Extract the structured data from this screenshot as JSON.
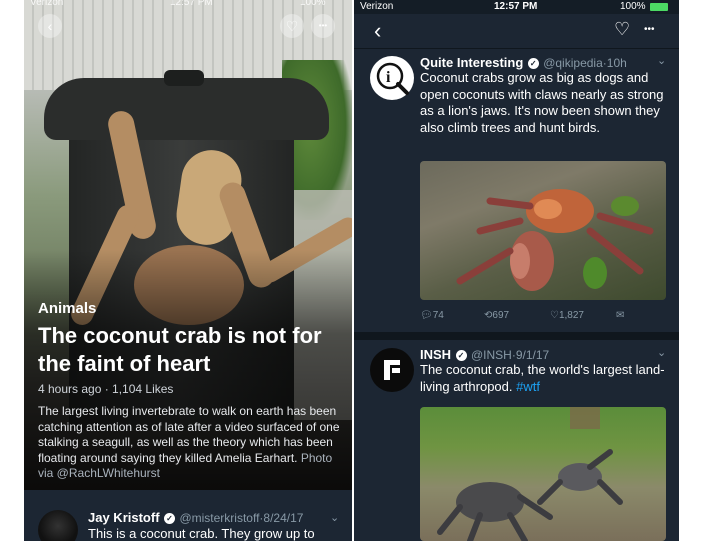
{
  "left_screen": {
    "status": {
      "carrier": "Verizon",
      "time": "12:57 PM",
      "battery": "100%"
    },
    "controls": {
      "back_icon": "‹",
      "like_icon": "♡",
      "more_icon": "•••"
    },
    "category": "Animals",
    "title": "The coconut crab is not for the faint of heart",
    "meta": "4 hours ago · 1,104 Likes",
    "description": "The largest living invertebrate to walk on earth has been catching attention as of late after a video surfaced of one stalking a seagull, as well as the theory which has been floating around saying they killed Amelia Earhart.",
    "photo_credit": "Photo via @RachLWhitehurst",
    "tweet": {
      "name": "Jay Kristoff",
      "handle": "@misterkristoff",
      "date": "8/24/17",
      "text": "This is a coconut crab. They grow up to"
    }
  },
  "right_screen": {
    "status": {
      "carrier": "Verizon",
      "time": "12:57 PM",
      "battery": "100%"
    },
    "nav": {
      "back_icon": "‹",
      "like_icon": "♡",
      "more_icon": "•••"
    },
    "tweets": [
      {
        "name": "Quite Interesting",
        "handle": "@qikipedia",
        "time": "10h",
        "text": "Coconut crabs grow as big as dogs and open coconuts with claws nearly as strong as a lion's jaws. It's now been shown they also climb trees and hunt birds.",
        "actions": {
          "replies": "74",
          "retweets": "697",
          "likes": "1,827"
        }
      },
      {
        "name": "INSH",
        "handle": "@INSH",
        "date": "9/1/17",
        "text": "The coconut crab, the world's largest land-living arthropod.",
        "hashtag": "#wtf"
      }
    ]
  },
  "colors": {
    "tweet_bg": "#1c2633",
    "link": "#1da1f2",
    "muted": "#8899a6"
  }
}
